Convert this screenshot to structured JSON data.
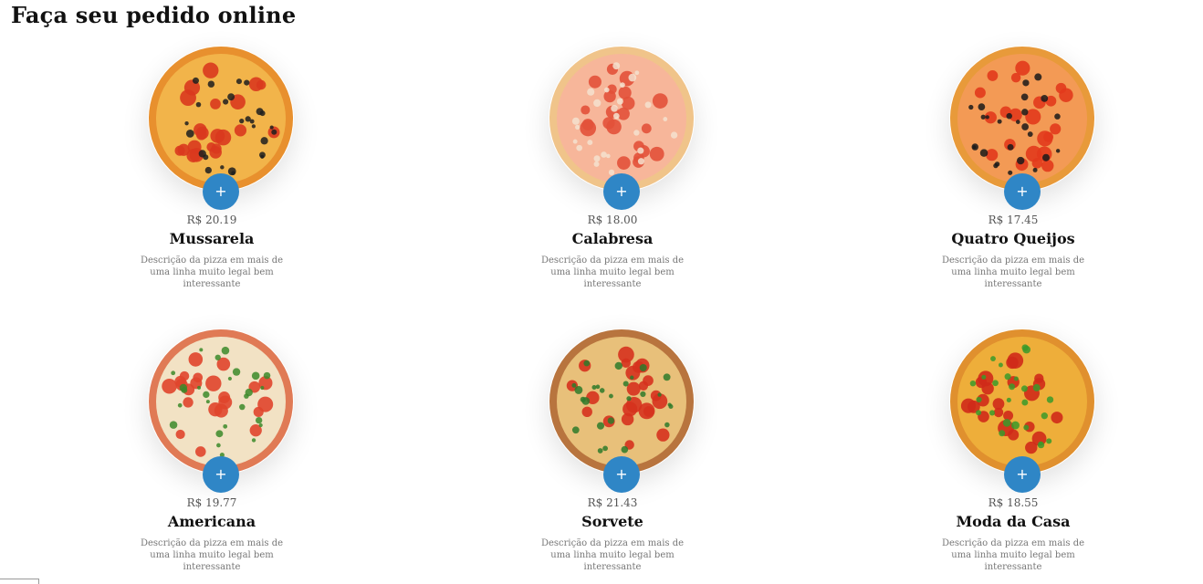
{
  "page": {
    "title": "Faça seu pedido online"
  },
  "pizzas": [
    {
      "price": "R$ 20.19",
      "name": "Mussarela",
      "description": "Descrição da pizza em mais de uma linha muito legal bem interessante",
      "add_label": "+",
      "crust": "#e8902e",
      "base": "#f2b44a",
      "topping": "#d9381e",
      "accent": "#1e1e1e"
    },
    {
      "price": "R$ 18.00",
      "name": "Calabresa",
      "description": "Descrição da pizza em mais de uma linha muito legal bem interessante",
      "add_label": "+",
      "crust": "#f0c48a",
      "base": "#f7b69a",
      "topping": "#e2513a",
      "accent": "#f4e2cf"
    },
    {
      "price": "R$ 17.45",
      "name": "Quatro Queijos",
      "description": "Descrição da pizza em mais de uma linha muito legal bem interessante",
      "add_label": "+",
      "crust": "#e89a3a",
      "base": "#f39a55",
      "topping": "#e23a1c",
      "accent": "#1a1a1a"
    },
    {
      "price": "R$ 19.77",
      "name": "Americana",
      "description": "Descrição da pizza em mais de uma linha muito legal bem interessante",
      "add_label": "+",
      "crust": "#e07a55",
      "base": "#f2e2c4",
      "topping": "#e0452c",
      "accent": "#3c8a2a"
    },
    {
      "price": "R$ 21.43",
      "name": "Sorvete",
      "description": "Descrição da pizza em mais de uma linha muito legal bem interessante",
      "add_label": "+",
      "crust": "#b8743e",
      "base": "#e8c07a",
      "topping": "#d6321e",
      "accent": "#2e7a2a"
    },
    {
      "price": "R$ 18.55",
      "name": "Moda da Casa",
      "description": "Descrição da pizza em mais de uma linha muito legal bem interessante",
      "add_label": "+",
      "crust": "#e0902e",
      "base": "#eeae3a",
      "topping": "#cf2a1a",
      "accent": "#3a9a2a"
    }
  ],
  "colors": {
    "add_button": "#2f86c6"
  }
}
